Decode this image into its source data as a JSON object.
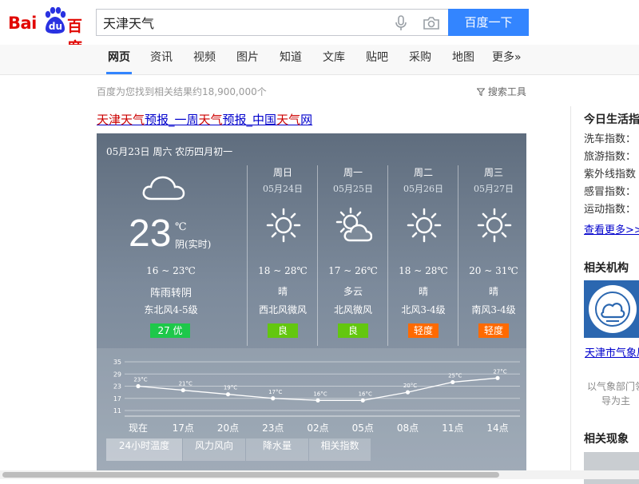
{
  "header": {
    "logo": {
      "text_bai": "Bai",
      "text_du": "du",
      "text_cn": "百度"
    },
    "search_value": "天津天气",
    "search_button": "百度一下",
    "icons": {
      "mic": "microphone-icon",
      "camera": "camera-icon"
    }
  },
  "tabs": [
    {
      "label": "网页",
      "active": true
    },
    {
      "label": "资讯"
    },
    {
      "label": "视频"
    },
    {
      "label": "图片"
    },
    {
      "label": "知道"
    },
    {
      "label": "文库"
    },
    {
      "label": "贴吧"
    },
    {
      "label": "采购"
    },
    {
      "label": "地图"
    },
    {
      "label": "更多»"
    }
  ],
  "results": {
    "count_text": "百度为您找到相关结果约18,900,000个",
    "search_tools": "搜索工具",
    "first_title": [
      {
        "t": "天津天气",
        "hl": true
      },
      {
        "t": "预报_一周",
        "hl": false
      },
      {
        "t": "天气",
        "hl": true
      },
      {
        "t": "预报_中国",
        "hl": false
      },
      {
        "t": "天气",
        "hl": true
      },
      {
        "t": "网",
        "hl": false
      }
    ]
  },
  "weather": {
    "date_line": "05月23日 周六 农历四月初一",
    "today": {
      "temp": "23",
      "unit": "℃",
      "realtime_label": "阴(实时)",
      "range": "16 ~ 23℃",
      "desc": "阵雨转阴",
      "wind": "东北风4-5级",
      "aqi": "27  优",
      "aqi_color": "#1ec84a",
      "icon": "cloud-icon"
    },
    "days": [
      {
        "week": "周日",
        "date": "05月24日",
        "range": "18 ~ 28℃",
        "desc": "晴",
        "wind": "西北风微风",
        "aqi": "良",
        "aqi_color": "#63c70f",
        "icon": "sun-icon"
      },
      {
        "week": "周一",
        "date": "05月25日",
        "range": "17 ~ 26℃",
        "desc": "多云",
        "wind": "北风微风",
        "aqi": "良",
        "aqi_color": "#63c70f",
        "icon": "partly-cloudy-icon"
      },
      {
        "week": "周二",
        "date": "05月26日",
        "range": "18 ~ 28℃",
        "desc": "晴",
        "wind": "北风3-4级",
        "aqi": "轻度",
        "aqi_color": "#ff6a00",
        "icon": "sun-icon"
      },
      {
        "week": "周三",
        "date": "05月27日",
        "range": "20 ~ 31℃",
        "desc": "晴",
        "wind": "南风3-4级",
        "aqi": "轻度",
        "aqi_color": "#ff6a00",
        "icon": "sun-icon"
      }
    ],
    "chart_tabs": [
      {
        "label": "24小时温度",
        "active": true
      },
      {
        "label": "风力风向"
      },
      {
        "label": "降水量"
      },
      {
        "label": "相关指数"
      }
    ]
  },
  "chart_data": {
    "type": "line",
    "x": [
      "现在",
      "17点",
      "20点",
      "23点",
      "02点",
      "05点",
      "08点",
      "11点",
      "14点"
    ],
    "y": [
      23,
      21,
      19,
      17,
      16,
      16,
      20,
      25,
      27
    ],
    "point_labels": [
      "23°C",
      "21°C",
      "19°C",
      "17°C",
      "16°C",
      "16°C",
      "20°C",
      "25°C",
      "27°C"
    ],
    "yticks": [
      "35",
      "29",
      "23",
      "17",
      "11"
    ],
    "ytick_values": [
      35,
      29,
      23,
      17,
      11
    ],
    "ylim": [
      11,
      35
    ]
  },
  "sidebar": {
    "life_title": "今日生活指",
    "life_items": [
      "洗车指数：",
      "旅游指数：",
      "紫外线指数",
      "感冒指数：",
      "运动指数："
    ],
    "more": "查看更多>>",
    "org_title": "相关机构",
    "org_name": "天津市气象局",
    "org_desc": "以气象部门领导为主",
    "phenom_title": "相关现象"
  }
}
